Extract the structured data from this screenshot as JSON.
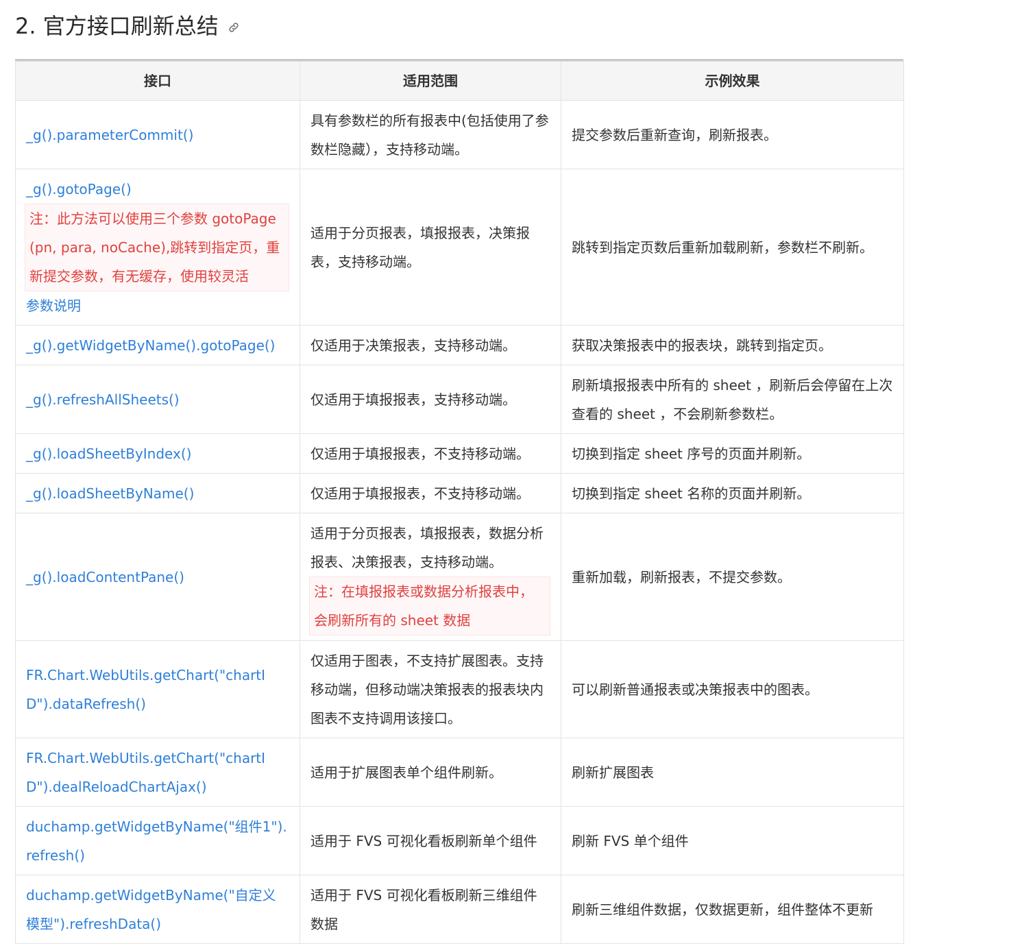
{
  "heading": {
    "title": "2. 官方接口刷新总结",
    "anchor_icon": "link-icon"
  },
  "table": {
    "headers": [
      "接口",
      "适用范围",
      "示例效果"
    ],
    "rows": [
      {
        "api": "_g().parameterCommit()",
        "scope": "具有参数栏的所有报表中(包括使用了参数栏隐藏），支持移动端。",
        "effect": "提交参数后重新查询，刷新报表。"
      },
      {
        "api": "_g().gotoPage()",
        "api_note": "注：此方法可以使用三个参数 gotoPage(pn, para, noCache),跳转到指定页，重新提交参数，有无缓存，使用较灵活",
        "api_link": "参数说明",
        "scope": "适用于分页报表，填报报表，决策报表，支持移动端。",
        "effect": "跳转到指定页数后重新加载刷新，参数栏不刷新。"
      },
      {
        "api": "_g().getWidgetByName().gotoPage()",
        "scope": "仅适用于决策报表，支持移动端。",
        "effect": "获取决策报表中的报表块，跳转到指定页。"
      },
      {
        "api": "_g().refreshAllSheets()",
        "scope": "仅适用于填报报表，支持移动端。",
        "effect": "刷新填报报表中所有的 sheet ，刷新后会停留在上次查看的 sheet ，不会刷新参数栏。"
      },
      {
        "api": "_g().loadSheetByIndex()",
        "scope": "仅适用于填报报表，不支持移动端。",
        "effect": "切换到指定 sheet 序号的页面并刷新。"
      },
      {
        "api": "_g().loadSheetByName()",
        "scope": "仅适用于填报报表，不支持移动端。",
        "effect": "切换到指定 sheet 名称的页面并刷新。"
      },
      {
        "api": "_g().loadContentPane()",
        "scope": "适用于分页报表，填报报表，数据分析报表、决策报表，支持移动端。",
        "scope_note": "注：在填报报表或数据分析报表中，会刷新所有的 sheet 数据",
        "effect": "重新加载，刷新报表，不提交参数。"
      },
      {
        "api": "FR.Chart.WebUtils.getChart(\"chartID\").dataRefresh()",
        "scope": "仅适用于图表，不支持扩展图表。支持移动端，但移动端决策报表的报表块内图表不支持调用该接口。",
        "effect": "可以刷新普通报表或决策报表中的图表。"
      },
      {
        "api": "FR.Chart.WebUtils.getChart(\"chartID\").dealReloadChartAjax()",
        "scope": "适用于扩展图表单个组件刷新。",
        "effect": "刷新扩展图表"
      },
      {
        "api": "duchamp.getWidgetByName(\"组件1\").refresh()",
        "scope": "适用于 FVS 可视化看板刷新单个组件",
        "effect": "刷新 FVS 单个组件"
      },
      {
        "api": "duchamp.getWidgetByName(\"自定义模型\").refreshData()",
        "scope": "适用于 FVS 可视化看板刷新三维组件数据",
        "effect": "刷新三维组件数据，仅数据更新，组件整体不更新"
      }
    ]
  },
  "colors": {
    "link": "#2e7fd8",
    "note_text": "#e0403f",
    "note_bg": "#fff7f7",
    "header_bg": "#f5f5f5"
  }
}
